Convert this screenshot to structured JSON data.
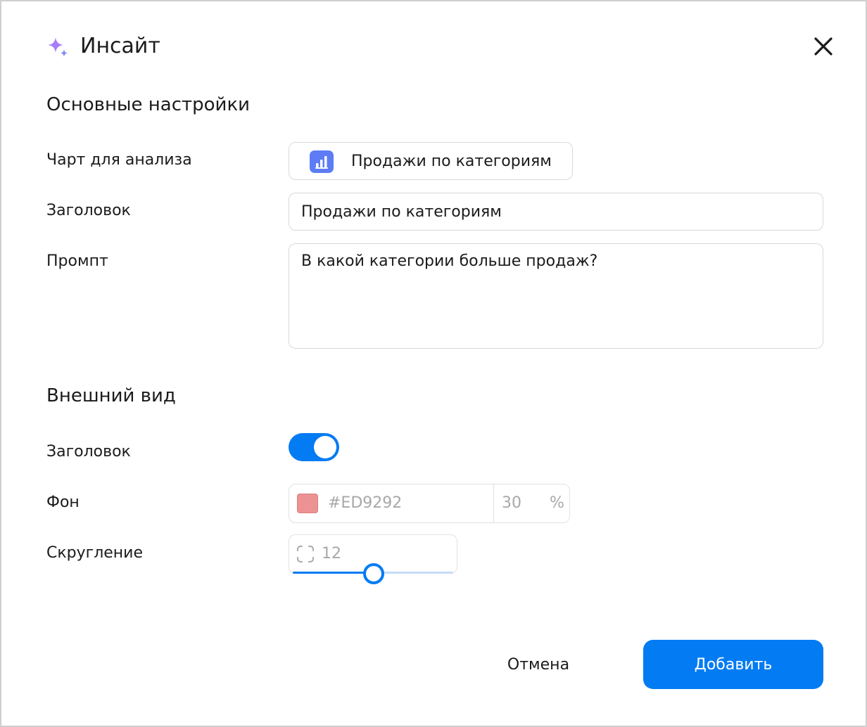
{
  "dialog": {
    "title": "Инсайт",
    "icon": "sparkle-icon",
    "close_icon": "close-icon"
  },
  "main_settings": {
    "section_title": "Основные настройки",
    "chart_label": "Чарт для анализа",
    "chart_value": "Продажи по категориям",
    "chart_icon": "bar-chart-icon",
    "title_label": "Заголовок",
    "title_value": "Продажи по категориям",
    "prompt_label": "Промпт",
    "prompt_value": "В какой категории больше продаж?"
  },
  "appearance": {
    "section_title": "Внешний вид",
    "header_label": "Заголовок",
    "header_enabled": true,
    "background_label": "Фон",
    "background_color": "#ED9292",
    "background_opacity": "30",
    "percent_sign": "%",
    "radius_label": "Скругление",
    "radius_value": "12",
    "radius_slider_fraction": 0.5
  },
  "footer": {
    "cancel_label": "Отмена",
    "add_label": "Добавить"
  },
  "colors": {
    "accent": "#027BF3",
    "sparkle": "#A97CF8",
    "chart_icon_bg": "#5D7CF5"
  }
}
